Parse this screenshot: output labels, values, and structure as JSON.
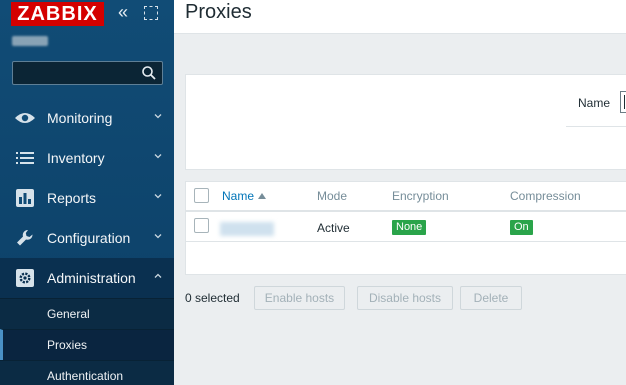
{
  "sidebar": {
    "logo": "ZABBIX",
    "search_placeholder": "",
    "menu": [
      {
        "label": "Monitoring",
        "icon": "eye-icon"
      },
      {
        "label": "Inventory",
        "icon": "list-icon"
      },
      {
        "label": "Reports",
        "icon": "bar-chart-icon"
      },
      {
        "label": "Configuration",
        "icon": "wrench-icon"
      },
      {
        "label": "Administration",
        "icon": "gear-icon"
      }
    ],
    "submenu": [
      {
        "label": "General"
      },
      {
        "label": "Proxies"
      },
      {
        "label": "Authentication"
      }
    ]
  },
  "page": {
    "title": "Proxies"
  },
  "filter": {
    "name_label": "Name"
  },
  "table": {
    "headers": {
      "name": "Name",
      "mode": "Mode",
      "encryption": "Encryption",
      "compression": "Compression"
    },
    "rows": [
      {
        "mode": "Active",
        "encryption": "None",
        "compression": "On"
      }
    ]
  },
  "footer": {
    "selected": "0 selected",
    "enable_hosts": "Enable hosts",
    "disable_hosts": "Disable hosts",
    "delete": "Delete"
  },
  "colors": {
    "sidebar_bg": "#114c76",
    "logo_bg": "#d40000",
    "badge_green": "#2aa44a",
    "link_blue": "#0275b8"
  }
}
